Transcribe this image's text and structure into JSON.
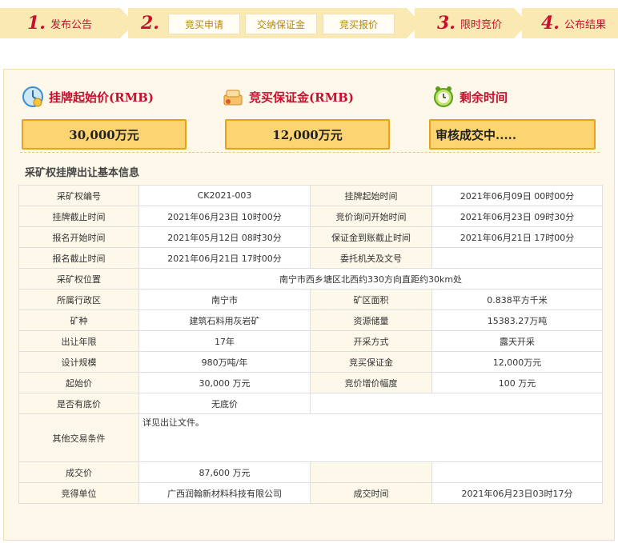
{
  "steps": [
    {
      "num": "1.",
      "label": "发布公告"
    },
    {
      "num": "2.",
      "label": ""
    },
    {
      "num": "3.",
      "label": "限时竞价"
    },
    {
      "num": "4.",
      "label": "公布结果"
    }
  ],
  "substeps": [
    "竞买申请",
    "交纳保证金",
    "竞买报价"
  ],
  "summary": {
    "start_price_label": "挂牌起始价(RMB)",
    "start_price_value": "30,000万元",
    "deposit_label": "竞买保证金(RMB)",
    "deposit_value": "12,000万元",
    "remaining_label": "剩余时间",
    "remaining_value": "审核成交中....."
  },
  "section_title": "采矿权挂牌出让基本信息",
  "table": {
    "r1": [
      "采矿权编号",
      "CK2021-003",
      "挂牌起始时间",
      "2021年06月09日 00时00分"
    ],
    "r2": [
      "挂牌截止时间",
      "2021年06月23日 10时00分",
      "竞价询问开始时间",
      "2021年06月23日 09时30分"
    ],
    "r3": [
      "报名开始时间",
      "2021年05月12日 08时30分",
      "保证金到账截止时间",
      "2021年06月21日 17时00分"
    ],
    "r4": [
      "报名截止时间",
      "2021年06月21日 17时00分",
      "委托机关及文号",
      ""
    ],
    "r5": [
      "采矿权位置",
      "南宁市西乡塘区北西约330方向直距约30km处"
    ],
    "r6": [
      "所属行政区",
      "南宁市",
      "矿区面积",
      "0.838平方千米"
    ],
    "r7": [
      "矿种",
      "建筑石料用灰岩矿",
      "资源储量",
      "15383.27万吨"
    ],
    "r8": [
      "出让年限",
      "17年",
      "开采方式",
      "露天开采"
    ],
    "r9": [
      "设计规模",
      "980万吨/年",
      "竞买保证金",
      "12,000万元"
    ],
    "r10": [
      "起始价",
      "30,000 万元",
      "竞价增价幅度",
      "100 万元"
    ],
    "r11": [
      "是否有底价",
      "无底价"
    ],
    "r12": [
      "其他交易条件",
      "详见出让文件。"
    ],
    "r13": [
      "成交价",
      "87,600 万元",
      "",
      ""
    ],
    "r14": [
      "竞得单位",
      "广西润翰新材料科技有限公司",
      "成交时间",
      "2021年06月23日03时17分"
    ]
  },
  "colors": {
    "accent": "#c8102e",
    "gold": "#fcd572",
    "panel": "#fdf8e9"
  }
}
